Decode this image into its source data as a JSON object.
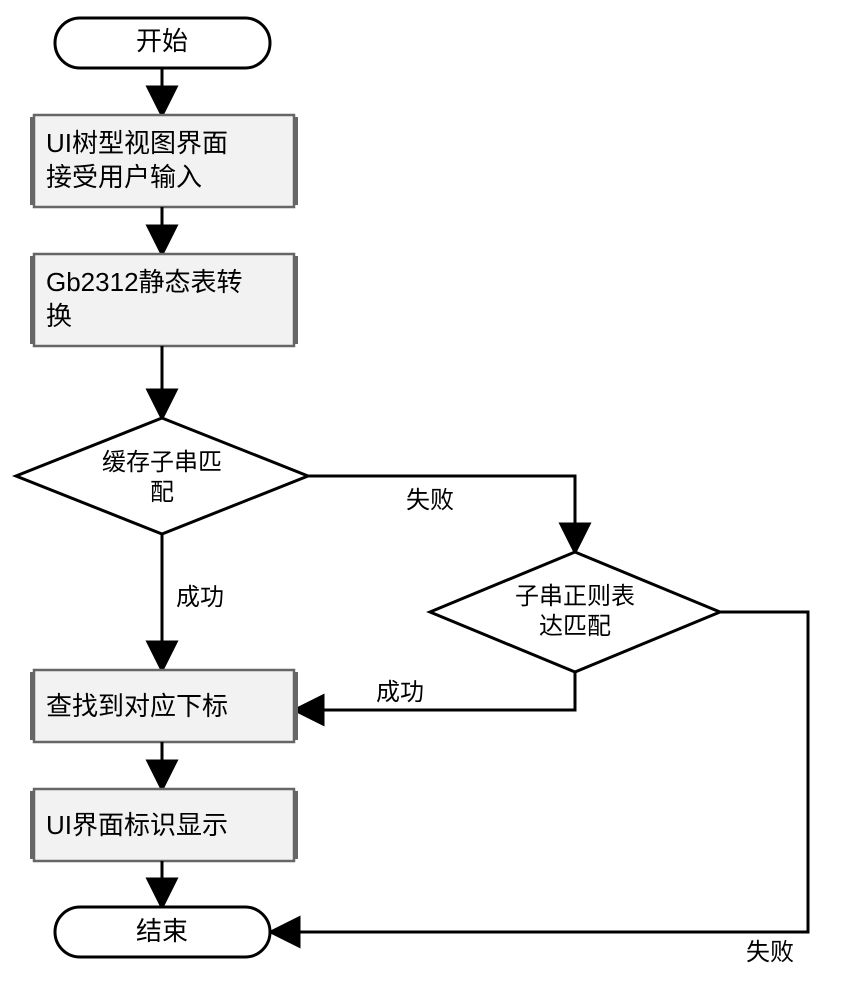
{
  "nodes": {
    "start": "开始",
    "step_input": "UI树型视图界面\n接受用户输入",
    "step_convert": "Gb2312静态表转换",
    "dec_cache": "缓存子串匹配",
    "dec_regex": "子串正则表达匹配",
    "step_index": "查找到对应下标",
    "step_display": "UI界面标识显示",
    "end": "结束"
  },
  "edges": {
    "success1": "成功",
    "fail1": "失败",
    "success2": "成功",
    "fail2": "失败"
  }
}
